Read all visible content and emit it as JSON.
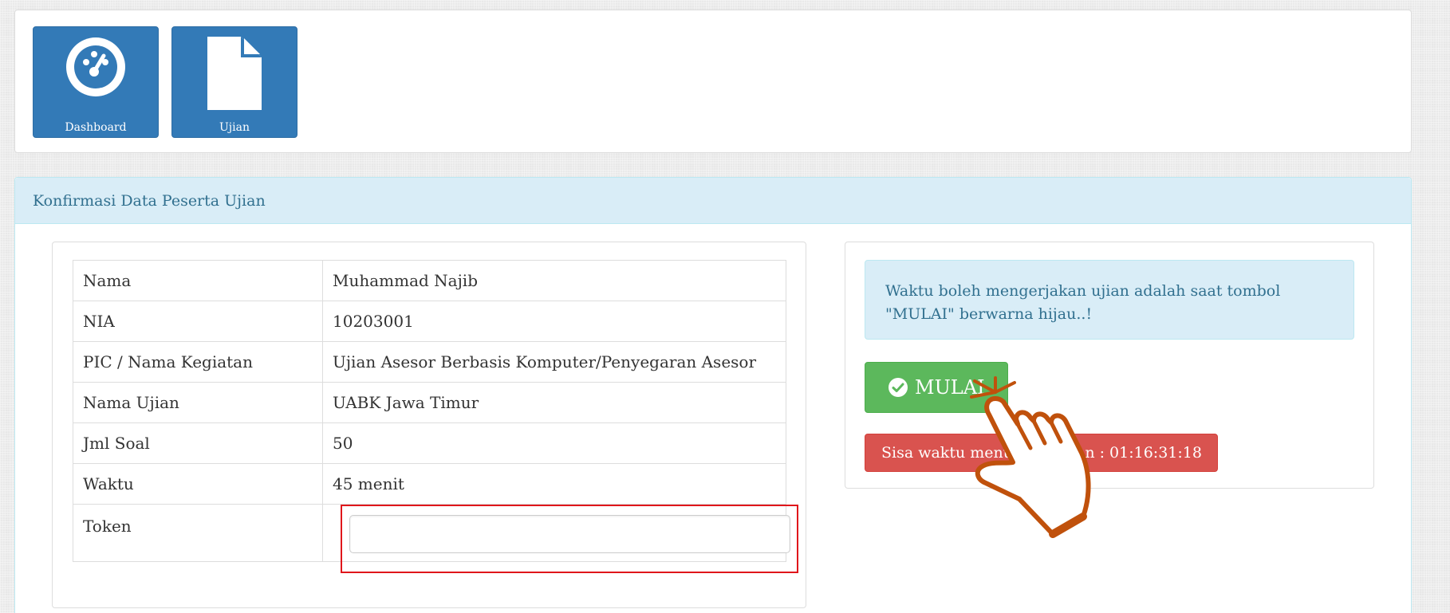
{
  "nav": {
    "tiles": [
      {
        "label": "Dashboard",
        "icon": "dashboard-icon"
      },
      {
        "label": "Ujian",
        "icon": "document-icon"
      }
    ]
  },
  "panel": {
    "heading": "Konfirmasi Data Peserta Ujian"
  },
  "info_table": {
    "rows": [
      {
        "label": "Nama",
        "value": "Muhammad Najib"
      },
      {
        "label": "NIA",
        "value": "10203001"
      },
      {
        "label": "PIC / Nama Kegiatan",
        "value": "Ujian Asesor Berbasis Komputer/Penyegaran Asesor"
      },
      {
        "label": "Nama Ujian",
        "value": "UABK Jawa Timur"
      },
      {
        "label": "Jml Soal",
        "value": "50"
      },
      {
        "label": "Waktu",
        "value": "45 menit"
      }
    ],
    "token": {
      "label": "Token",
      "value": "",
      "placeholder": ""
    }
  },
  "side": {
    "notice": "Waktu boleh mengerjakan ujian adalah saat tombol \"MULAI\" berwarna hijau..!",
    "start_button_label": "MULAI",
    "timer_text": "Sisa waktu menunggu ujian : 01:16:31:18"
  },
  "colors": {
    "primary": "#337ab7",
    "info_bg": "#d9edf7",
    "info_text": "#31708f",
    "success": "#5cb85c",
    "danger": "#d9534f",
    "highlight": "#e0161b",
    "pointer": "#c0510c"
  }
}
